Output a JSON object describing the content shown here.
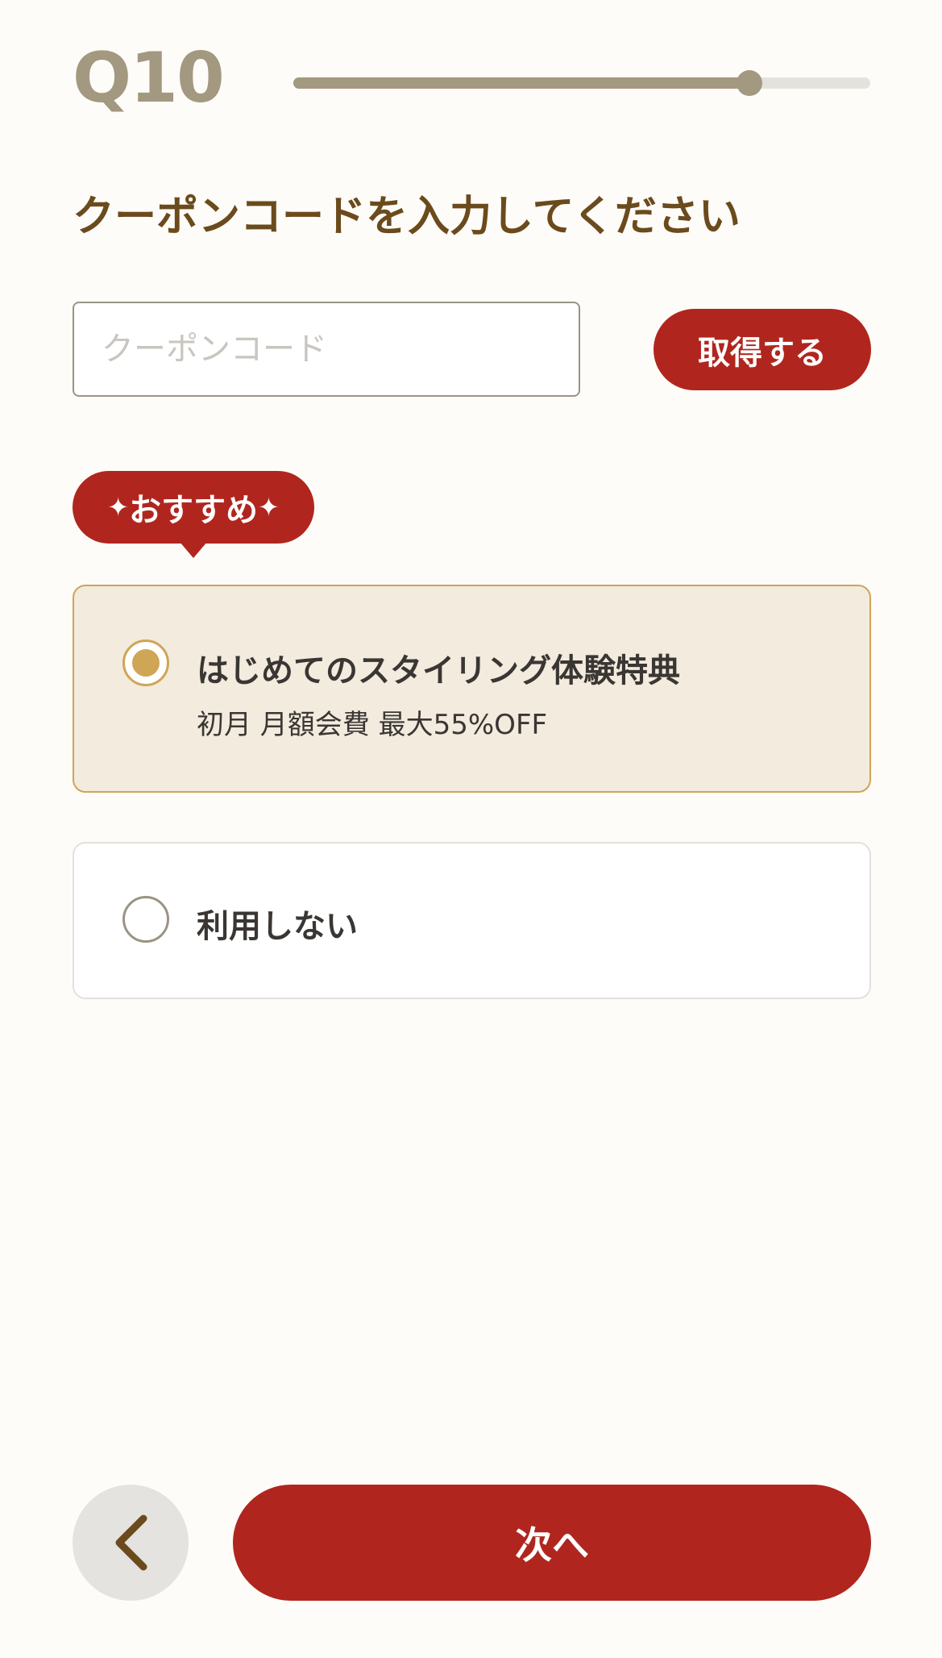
{
  "header": {
    "question_label": "Q10",
    "progress_fraction": 0.79,
    "progress_color": "#A39880"
  },
  "title": "クーポンコードを入力してください",
  "coupon": {
    "value": "",
    "placeholder": "クーポンコード",
    "get_button_label": "取得する"
  },
  "badge": {
    "star_icon": "sparkle-icon",
    "label": "おすすめ",
    "star_glyph": "✦"
  },
  "options": [
    {
      "title": "はじめてのスタイリング体験特典",
      "subtitle": "初月 月額会費 最大55%OFF",
      "selected": true
    },
    {
      "title": "利用しない",
      "selected": false
    }
  ],
  "footer": {
    "back_icon": "chevron-left-icon",
    "next_label": "次へ"
  },
  "colors": {
    "accent_red": "#B0261E",
    "gold": "#CFA556",
    "title_brown": "#6B4A1C",
    "background": "#FDFCF8"
  }
}
